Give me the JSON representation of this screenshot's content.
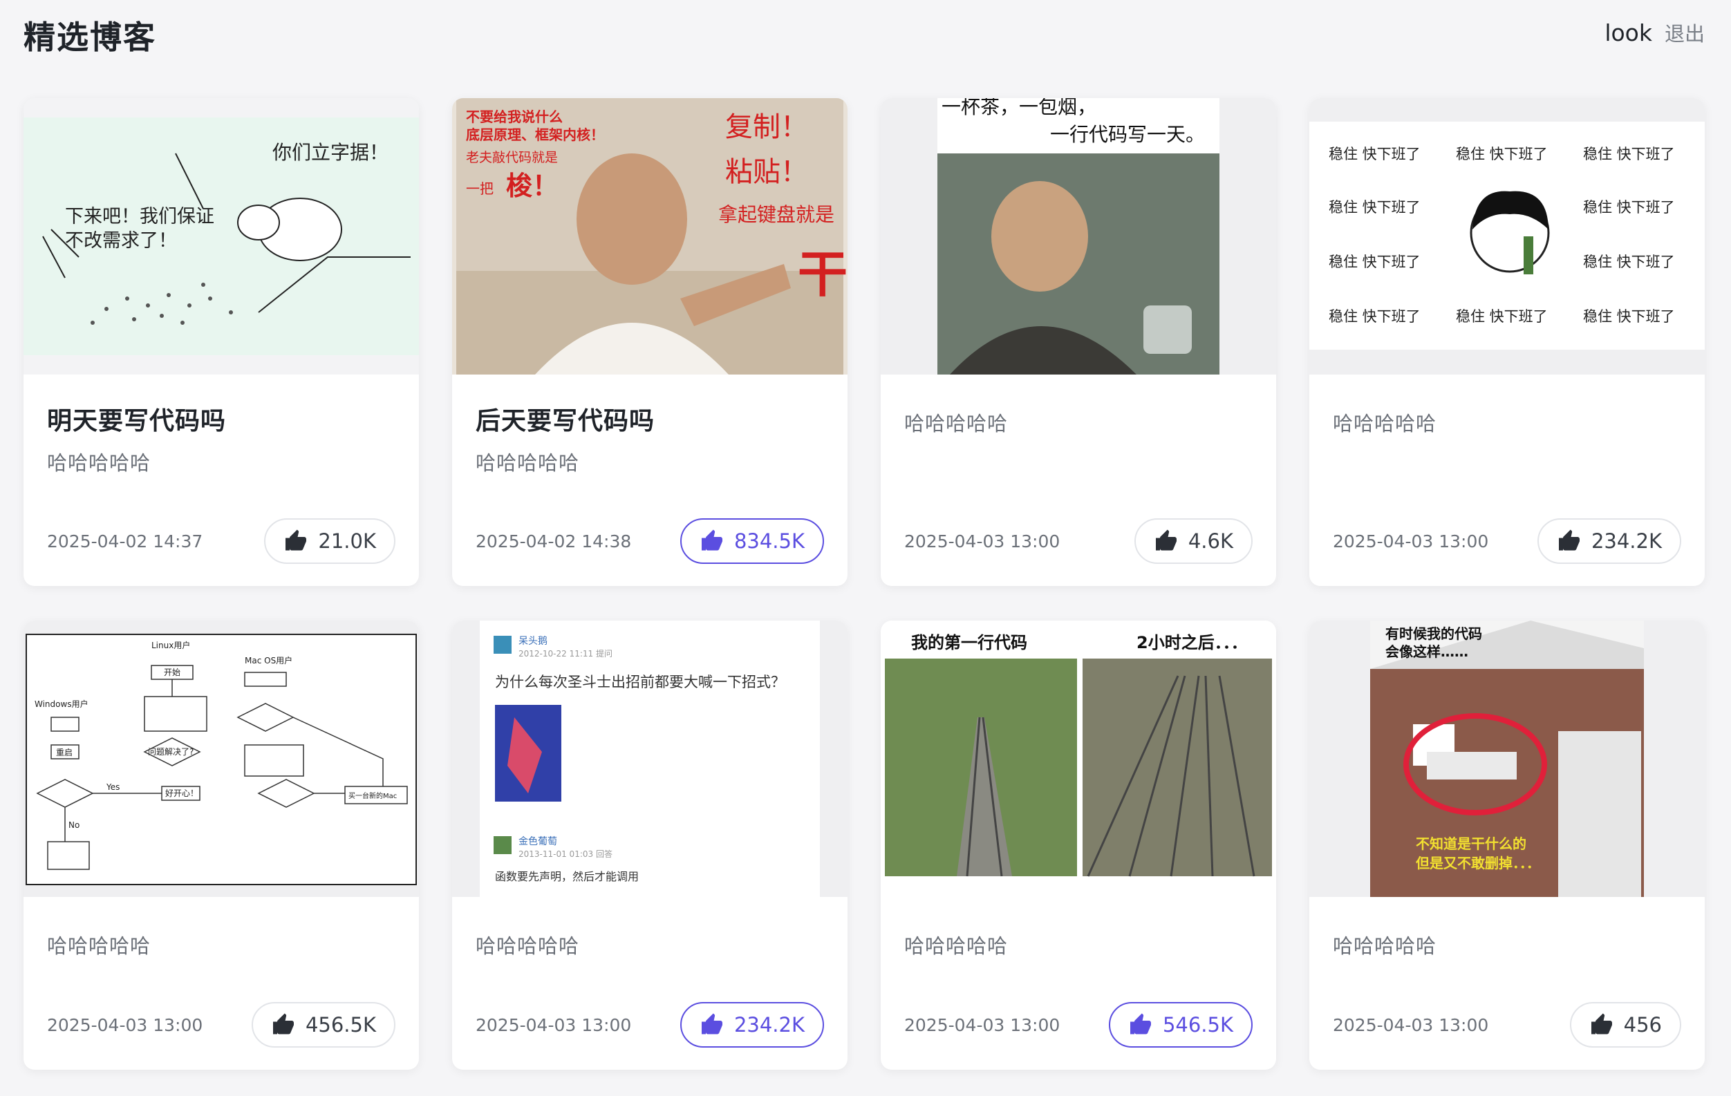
{
  "header": {
    "title": "精选博客",
    "username": "look",
    "logout_label": "退出"
  },
  "colors": {
    "accent": "#5b4ee0",
    "background": "#f5f5f7"
  },
  "cards": [
    {
      "title": "明天要写代码吗",
      "desc": "哈哈哈哈哈",
      "date": "2025-04-02 14:37",
      "likes": "21.0K",
      "liked": false,
      "image_text": [
        "你们立字据！",
        "下来吧！我们保证",
        "不改需求了！"
      ]
    },
    {
      "title": "后天要写代码吗",
      "desc": "哈哈哈哈哈",
      "date": "2025-04-02 14:38",
      "likes": "834.5K",
      "liked": true,
      "image_text": [
        "不要给我说什么",
        "底层原理、框架内核！",
        "老夫敲代码就是",
        "一把",
        "梭！",
        "复制！",
        "粘贴！",
        "拿起键盘就是",
        "干"
      ]
    },
    {
      "desc": "哈哈哈哈哈",
      "date": "2025-04-03 13:00",
      "likes": "4.6K",
      "liked": false,
      "image_text": [
        "一杯茶，一包烟，",
        "一行代码写一天。"
      ]
    },
    {
      "desc": "哈哈哈哈哈",
      "date": "2025-04-03 13:00",
      "likes": "234.2K",
      "liked": false,
      "image_text": [
        "稳住 快下班了"
      ]
    },
    {
      "desc": "哈哈哈哈哈",
      "date": "2025-04-03 13:00",
      "likes": "456.5K",
      "liked": false,
      "image_text": [
        "Linux用户",
        "Mac OS用户",
        "Windows用户",
        "开始",
        "重启",
        "问题解决了?",
        "Yes",
        "No",
        "好开心！",
        "买一台新的Mac"
      ]
    },
    {
      "desc": "哈哈哈哈哈",
      "date": "2025-04-03 13:00",
      "likes": "234.2K",
      "liked": true,
      "image_text": [
        "呆头鹅",
        "2012-10-22 11:11 提问",
        "为什么每次圣斗士出招前都要大喊一下招式？",
        "金色葡萄",
        "2013-11-01 01:03 回答",
        "函数要先声明，然后才能调用"
      ]
    },
    {
      "desc": "哈哈哈哈哈",
      "date": "2025-04-03 13:00",
      "likes": "546.5K",
      "liked": true,
      "image_text": [
        "我的第一行代码",
        "2小时之后．．．"
      ]
    },
    {
      "desc": "哈哈哈哈哈",
      "date": "2025-04-03 13:00",
      "likes": "456",
      "liked": false,
      "image_text": [
        "有时候我的代码",
        "会像这样……",
        "不知道是干什么的",
        "但是又不敢删掉．．．"
      ]
    }
  ]
}
